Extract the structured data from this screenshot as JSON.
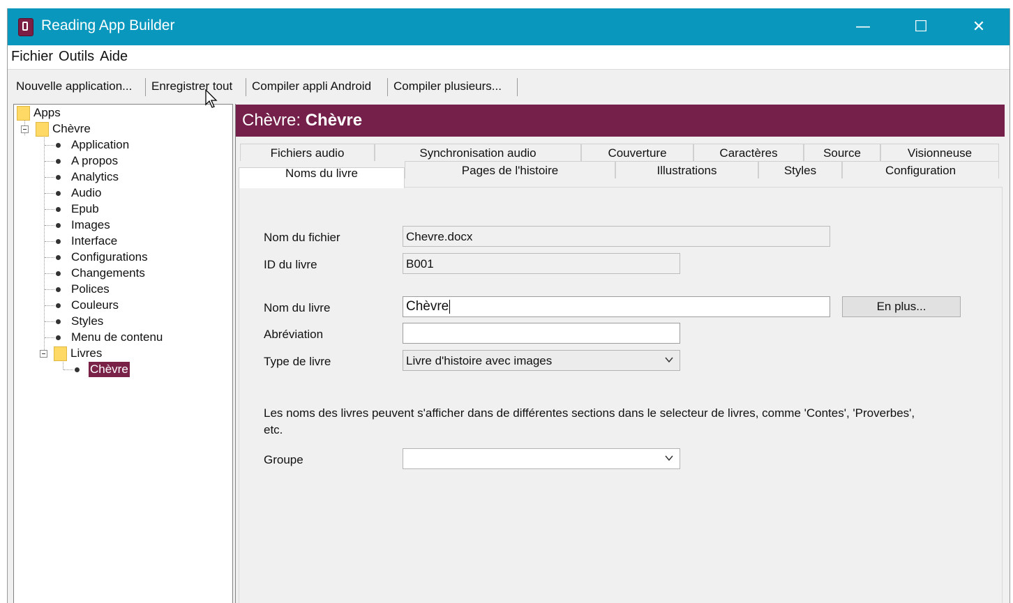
{
  "window": {
    "title": "Reading App Builder",
    "controls": {
      "minimize": "—",
      "maximize": "☐",
      "close": "✕"
    }
  },
  "menu": [
    "Fichier",
    "Outils",
    "Aide"
  ],
  "toolbar": [
    "Nouvelle application...",
    "Enregistrer tout",
    "Compiler appli Android",
    "Compiler plusieurs..."
  ],
  "tree": {
    "root": "Apps",
    "app": "Chèvre",
    "app_children": [
      "Application",
      "A propos",
      "Analytics",
      "Audio",
      "Epub",
      "Images",
      "Interface",
      "Configurations",
      "Changements",
      "Polices",
      "Couleurs",
      "Styles",
      "Menu de contenu"
    ],
    "books_folder": "Livres",
    "books": [
      "Chèvre"
    ]
  },
  "header": {
    "prefix": "Chèvre:",
    "name": "Chèvre"
  },
  "tabs_row1": [
    "Fichiers audio",
    "Synchronisation audio",
    "Couverture",
    "Caractères",
    "Source",
    "Visionneuse"
  ],
  "tabs_row2": [
    "Noms du livre",
    "Pages de l'histoire",
    "Illustrations",
    "Styles",
    "Configuration"
  ],
  "form": {
    "filename_label": "Nom du fichier",
    "filename_value": "Chevre.docx",
    "bookid_label": "ID du livre",
    "bookid_value": "B001",
    "bookname_label": "Nom du livre",
    "bookname_value": "Chèvre",
    "more_button": "En plus...",
    "abbrev_label": "Abréviation",
    "abbrev_value": "",
    "type_label": "Type de livre",
    "type_value": "Livre d'histoire avec images",
    "note": "Les noms des livres peuvent s'afficher dans de différentes sections dans le selecteur de livres, comme 'Contes', 'Proverbes', etc.",
    "group_label": "Groupe",
    "group_value": ""
  },
  "colors": {
    "titlebar": "#0a97bd",
    "accent": "#74204a",
    "selection": "#7a2148"
  }
}
